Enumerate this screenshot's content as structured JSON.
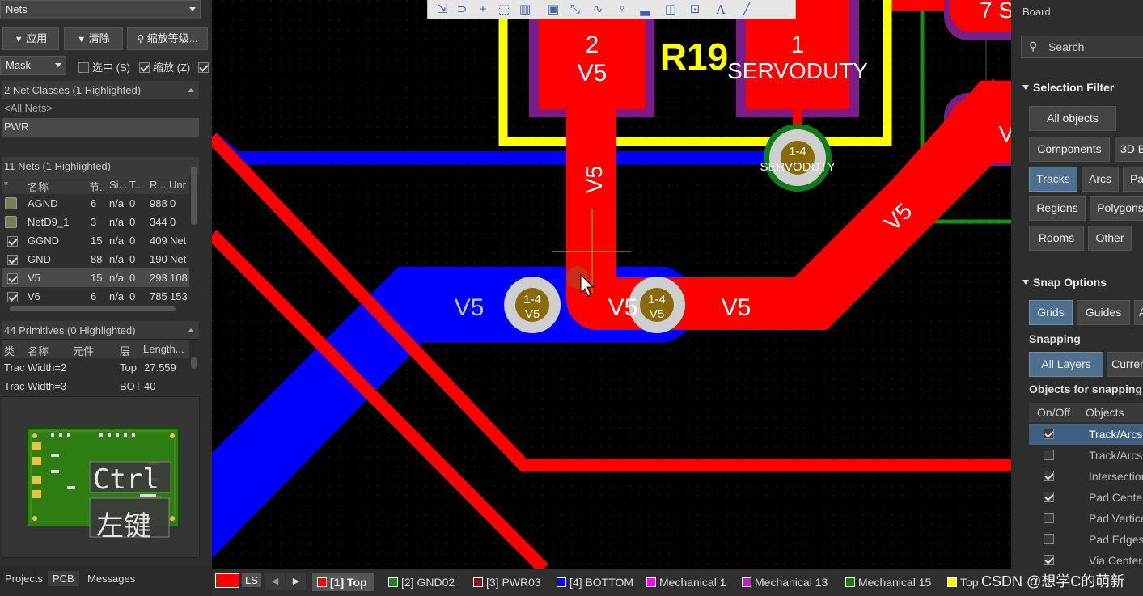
{
  "left_panel": {
    "nets_dropdown": "Nets",
    "buttons": {
      "apply": "应用",
      "clear": "清除",
      "zoom": "缩放等级..."
    },
    "mask_dropdown": "Mask",
    "options": {
      "select": "选中 (S)",
      "zoom": "缩放 (Z)"
    },
    "net_classes_header": "2 Net Classes (1 Highlighted)",
    "net_classes": [
      "<All Nets>",
      "PWR"
    ],
    "nets_header": "11 Nets (1 Highlighted)",
    "nets_columns": [
      "*",
      "名称",
      "节..",
      "Si...",
      "T...",
      "R...",
      "Unr"
    ],
    "nets": [
      {
        "name": "AGND",
        "nodes": "6",
        "si": "n/a",
        "t": "0",
        "r": "988",
        "unr": "0"
      },
      {
        "name": "NetD9_1",
        "nodes": "3",
        "si": "n/a",
        "t": "0",
        "r": "344",
        "unr": "0"
      },
      {
        "name": "GGND",
        "nodes": "15",
        "si": "n/a",
        "t": "0",
        "r": "409",
        "unr": "Net"
      },
      {
        "name": "GND",
        "nodes": "88",
        "si": "n/a",
        "t": "0",
        "r": "190",
        "unr": "Net"
      },
      {
        "name": "V5",
        "nodes": "15",
        "si": "n/a",
        "t": "0",
        "r": "293",
        "unr": "108"
      },
      {
        "name": "V6",
        "nodes": "6",
        "si": "n/a",
        "t": "0",
        "r": "785",
        "unr": "153"
      }
    ],
    "primitives_header": "44 Primitives (0 Highlighted)",
    "primitives_columns": [
      "类",
      "名称",
      "元件",
      "层",
      "Length..."
    ],
    "primitives": [
      {
        "name": "Trac Width=2",
        "layer": "Top",
        "length": "27.559"
      },
      {
        "name": "Trac Width=3",
        "layer": "BOT",
        "length": "40"
      }
    ],
    "overlay_keys": [
      "Ctrl",
      "左键"
    ],
    "bottom_tabs": [
      "Projects",
      "PCB",
      "Messages"
    ]
  },
  "canvas": {
    "labels": {
      "pad2_num": "2",
      "pad2_net": "V5",
      "designator": "R19",
      "pad1_num": "1",
      "pad1_net": "SERVODUTY",
      "via_top_num": "1-4",
      "via_top_net": "SERVODUTY",
      "trace_v5_vertical": "V5",
      "trace_v5_diag": "V5",
      "blue_v5": "V5",
      "via_left_num": "1-4",
      "via_left_net": "V5",
      "trace_v5_mid": "V5",
      "via_right_num": "1-4",
      "via_right_net": "V5",
      "trace_v5_right": "V5",
      "corner_text": "7 S",
      "right_v": "V"
    }
  },
  "layer_bar": {
    "ls": "LS",
    "layers": [
      {
        "name": "[1] Top",
        "color": "#ff0000",
        "active": true
      },
      {
        "name": "[2] GND02",
        "color": "#1a8a1a"
      },
      {
        "name": "[3] PWR03",
        "color": "#8a1010"
      },
      {
        "name": "[4] BOTTOM",
        "color": "#0000ff"
      },
      {
        "name": "Mechanical 1",
        "color": "#ff00ff"
      },
      {
        "name": "Mechanical 13",
        "color": "#c020c0"
      },
      {
        "name": "Mechanical 15",
        "color": "#108010"
      },
      {
        "name": "Top",
        "color": "#ffff00"
      }
    ]
  },
  "right_panel": {
    "board_label": "Board",
    "search_placeholder": "Search",
    "selection_filter_title": "Selection Filter",
    "filter_buttons": [
      "All objects",
      "Components",
      "3D B",
      "Tracks",
      "Arcs",
      "Pa",
      "Regions",
      "Polygons",
      "Rooms",
      "Other"
    ],
    "snap_options_title": "Snap Options",
    "snap_buttons": [
      "Grids",
      "Guides",
      "A"
    ],
    "snapping_label": "Snapping",
    "snapping_buttons": [
      "All Layers",
      "Curren"
    ],
    "objects_for_snapping_label": "Objects for snapping",
    "snap_table_columns": [
      "On/Off",
      "Objects"
    ],
    "snap_objects": [
      {
        "name": "Track/Arcs",
        "on": true,
        "selected": true
      },
      {
        "name": "Track/Arcs",
        "on": false
      },
      {
        "name": "Intersection",
        "on": true
      },
      {
        "name": "Pad Centers",
        "on": true
      },
      {
        "name": "Pad Vertices",
        "on": false
      },
      {
        "name": "Pad Edges",
        "on": false
      },
      {
        "name": "Via Centers",
        "on": true
      }
    ]
  },
  "watermark": "CSDN @想学C的萌新"
}
